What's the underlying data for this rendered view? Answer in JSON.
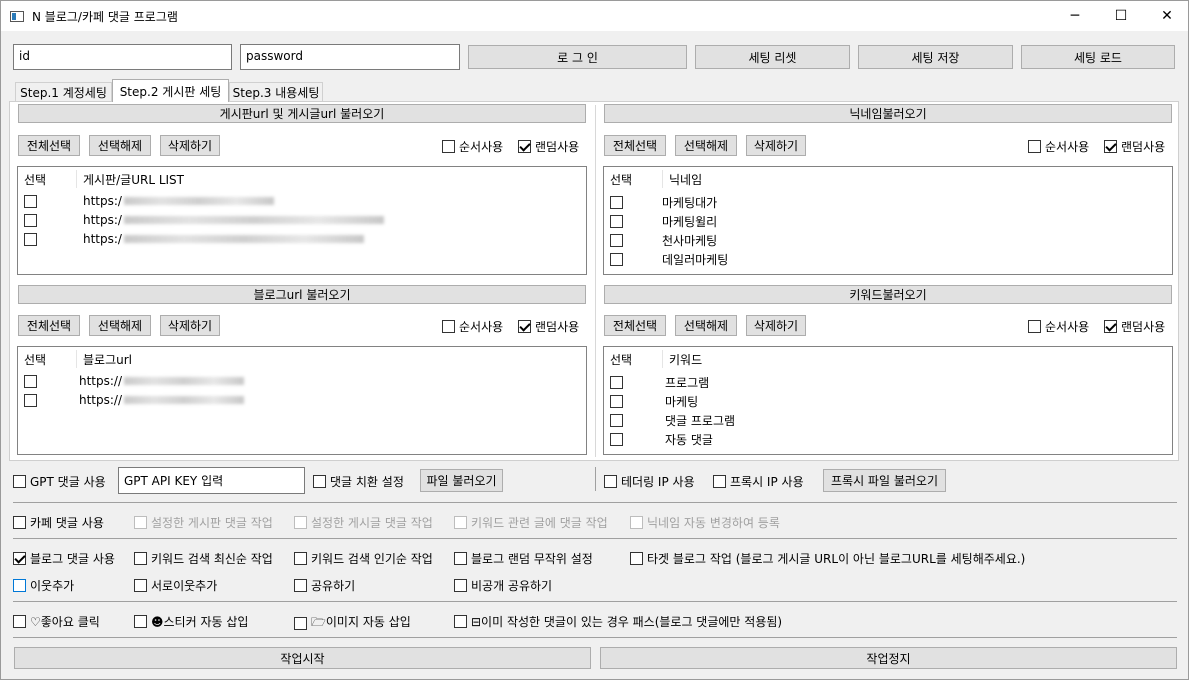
{
  "window": {
    "title": "N 블로그/카페 댓글 프로그램",
    "min": "─",
    "max": "☐",
    "close": "✕"
  },
  "login": {
    "id_value": "id",
    "pw_value": "password",
    "login": "로 그 인",
    "reset": "세팅 리셋",
    "save": "세팅 저장",
    "load": "세팅 로드"
  },
  "tabs": [
    "Step.1 계정세팅",
    "Step.2 게시판 세팅",
    "Step.3 내용세팅"
  ],
  "common": {
    "select_all": "전체선택",
    "deselect": "선택해제",
    "delete": "삭제하기",
    "seq": "순서사용",
    "rand": "랜덤사용",
    "col_select": "선택"
  },
  "board": {
    "header": "게시판url 및 게시글url 불러오기",
    "col": "게시판/글URL LIST",
    "rows": [
      "https:/",
      "https:/",
      "https:/"
    ]
  },
  "nick": {
    "header": "닉네임불러오기",
    "col": "닉네임",
    "rows": [
      "마케팅대가",
      "마케팅윌리",
      "천사마케팅",
      "데일러마케팅"
    ]
  },
  "blog": {
    "header": "블로그url 불러오기",
    "col": "블로그url",
    "rows": [
      "https://",
      "https://"
    ]
  },
  "keyword": {
    "header": "키워드불러오기",
    "col": "키워드",
    "rows": [
      "프로그램",
      "마케팅",
      "댓글 프로그램",
      "자동 댓글"
    ]
  },
  "gpt": {
    "use": "GPT 댓글 사용",
    "key": "GPT API KEY 입력",
    "replace": "댓글 치환 설정",
    "file": "파일 불러오기"
  },
  "proxy": {
    "tether": "테더링 IP 사용",
    "proxy": "프록시 IP 사용",
    "file": "프록시 파일 불러오기"
  },
  "cafe": {
    "use": "카페 댓글 사용",
    "o1": "설정한 게시판 댓글 작업",
    "o2": "설정한 게시글 댓글 작업",
    "o3": "키워드 관련 글에 댓글 작업",
    "o4": "닉네임 자동 변경하여 등록"
  },
  "blogopt": {
    "use": "블로그 댓글 사용",
    "o1": "키워드 검색 최신순 작업",
    "o2": "키워드 검색 인기순 작업",
    "o3": "블로그 랜덤 무작위 설정",
    "o4": "타겟 블로그 작업 (블로그 게시글 URL이 아닌 블로그URL를 세팅해주세요.)",
    "n1": "이웃추가",
    "n2": "서로이웃추가",
    "n3": "공유하기",
    "n4": "비공개 공유하기"
  },
  "extra": {
    "like": "♡좋아요 클릭",
    "sticker": "☻스티커 자동 삽입",
    "image": "🗁이미지 자동 삽입",
    "pass": "⊟이미 작성한 댓글이 있는 경우 패스(블로그 댓글에만 적용됨)"
  },
  "actions": {
    "start": "작업시작",
    "stop": "작업정지"
  }
}
